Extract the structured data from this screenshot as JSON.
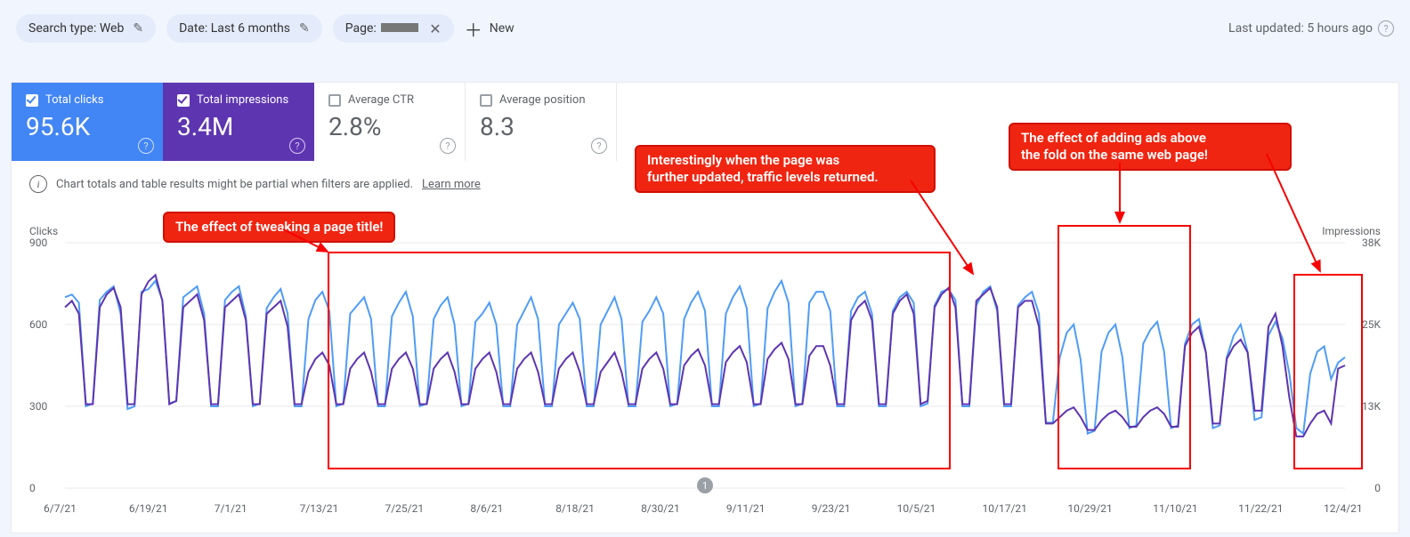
{
  "filters": {
    "search_type": "Search type: Web",
    "date": "Date: Last 6 months",
    "page_prefix": "Page: ",
    "new_label": "New"
  },
  "updated_label": "Last updated: 5 hours ago",
  "metrics": {
    "clicks": {
      "label": "Total clicks",
      "value": "95.6K"
    },
    "impressions": {
      "label": "Total impressions",
      "value": "3.4M"
    },
    "ctr": {
      "label": "Average CTR",
      "value": "2.8%"
    },
    "position": {
      "label": "Average position",
      "value": "8.3"
    }
  },
  "note": {
    "text": "Chart totals and table results might be partial when filters are applied.",
    "learn": "Learn more"
  },
  "axes": {
    "left_label": "Clicks",
    "right_label": "Impressions",
    "left_ticks": [
      "900",
      "600",
      "300",
      "0"
    ],
    "right_ticks": [
      "38K",
      "25K",
      "13K",
      "0"
    ],
    "x_ticks": [
      "6/7/21",
      "6/19/21",
      "7/1/21",
      "7/13/21",
      "7/25/21",
      "8/6/21",
      "8/18/21",
      "8/30/21",
      "9/11/21",
      "9/23/21",
      "10/5/21",
      "10/17/21",
      "10/29/21",
      "11/10/21",
      "11/22/21",
      "12/4/21"
    ]
  },
  "annotations": {
    "a1": "The effect of tweaking a page title!",
    "a2": "Interestingly when the page was\nfurther updated, traffic levels returned.",
    "a3": "The effect of adding ads above\nthe fold on the same web page!"
  },
  "scrub": "1",
  "chart_data": {
    "type": "line",
    "xlabel": "",
    "title": "",
    "y_left": {
      "label": "Clicks",
      "range": [
        0,
        900
      ]
    },
    "y_right": {
      "label": "Impressions",
      "range": [
        0,
        38000
      ]
    },
    "x_start": "2021-06-07",
    "x_end": "2021-12-08",
    "x_count": 185,
    "series": [
      {
        "name": "Total clicks",
        "axis": "left",
        "color": "#4f9cf7",
        "values": [
          700,
          710,
          680,
          300,
          310,
          690,
          720,
          740,
          640,
          290,
          300,
          720,
          730,
          760,
          690,
          310,
          320,
          700,
          720,
          740,
          640,
          300,
          300,
          690,
          720,
          740,
          630,
          300,
          310,
          660,
          700,
          730,
          640,
          300,
          300,
          620,
          690,
          720,
          650,
          300,
          310,
          640,
          670,
          700,
          620,
          300,
          300,
          630,
          680,
          720,
          630,
          300,
          310,
          620,
          670,
          700,
          600,
          300,
          310,
          610,
          640,
          680,
          600,
          300,
          300,
          600,
          650,
          700,
          620,
          300,
          300,
          600,
          640,
          680,
          620,
          300,
          300,
          600,
          650,
          700,
          620,
          300,
          300,
          610,
          650,
          700,
          640,
          300,
          310,
          620,
          680,
          720,
          650,
          300,
          300,
          640,
          700,
          740,
          660,
          300,
          310,
          660,
          720,
          760,
          680,
          300,
          310,
          680,
          720,
          720,
          650,
          300,
          300,
          650,
          700,
          720,
          640,
          300,
          300,
          650,
          700,
          720,
          680,
          300,
          310,
          670,
          720,
          730,
          690,
          300,
          300,
          670,
          720,
          740,
          650,
          300,
          300,
          670,
          700,
          720,
          640,
          240,
          240,
          480,
          570,
          600,
          470,
          200,
          210,
          500,
          570,
          600,
          480,
          220,
          230,
          530,
          580,
          610,
          500,
          220,
          230,
          530,
          600,
          620,
          500,
          220,
          230,
          480,
          560,
          600,
          500,
          250,
          260,
          560,
          610,
          550,
          420,
          220,
          200,
          420,
          500,
          520,
          400,
          460,
          480
        ]
      },
      {
        "name": "Total impressions",
        "axis": "right",
        "color": "#5e35b1",
        "values": [
          28000,
          29000,
          27000,
          13000,
          13000,
          28000,
          30000,
          31000,
          28000,
          13000,
          13000,
          30000,
          32000,
          33000,
          29000,
          13000,
          13500,
          28000,
          29000,
          30000,
          26000,
          13000,
          13000,
          28000,
          29000,
          30000,
          26000,
          13000,
          13000,
          27000,
          28000,
          29000,
          25000,
          13000,
          13000,
          18000,
          20000,
          21000,
          19000,
          13000,
          13000,
          18500,
          20000,
          21000,
          18000,
          13000,
          13000,
          18500,
          20000,
          21000,
          18500,
          13000,
          13000,
          18500,
          20000,
          21000,
          18000,
          13000,
          13000,
          18500,
          20000,
          21000,
          18000,
          13000,
          13000,
          18500,
          20000,
          21000,
          18000,
          13000,
          13000,
          18500,
          20000,
          21000,
          18000,
          13000,
          13000,
          18000,
          19500,
          21000,
          18000,
          13000,
          13000,
          18500,
          20000,
          21000,
          18500,
          13000,
          13000,
          19000,
          20500,
          21500,
          19000,
          13000,
          13000,
          19500,
          21000,
          22000,
          19500,
          13000,
          13000,
          20000,
          21500,
          22500,
          20000,
          13000,
          13000,
          20500,
          22000,
          22000,
          19000,
          13000,
          13000,
          26000,
          28000,
          29000,
          26000,
          13000,
          13000,
          27000,
          29000,
          30000,
          27000,
          13000,
          13500,
          28000,
          30000,
          31000,
          28000,
          13000,
          13000,
          29000,
          30000,
          31000,
          28000,
          13000,
          13000,
          28000,
          29000,
          29000,
          25000,
          10000,
          10000,
          11000,
          12000,
          12500,
          11000,
          9000,
          9000,
          10500,
          11500,
          12000,
          11000,
          9500,
          9500,
          11000,
          12000,
          12500,
          11500,
          9500,
          9500,
          22000,
          24000,
          25000,
          21000,
          10000,
          10000,
          20000,
          22000,
          23000,
          21000,
          12000,
          12000,
          25000,
          27000,
          22000,
          14000,
          8000,
          8000,
          10000,
          11500,
          12000,
          10000,
          18500,
          19000
        ]
      }
    ]
  }
}
